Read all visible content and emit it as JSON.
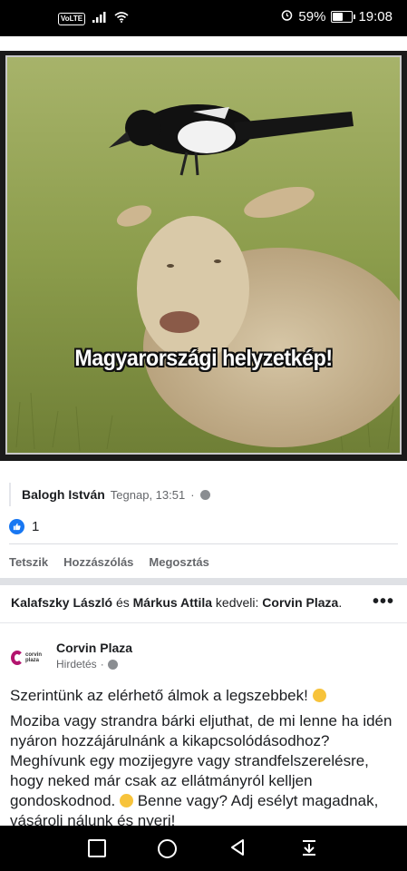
{
  "status_bar": {
    "volte": "VoLTE",
    "battery_percent": "59%",
    "battery_level": 0.59,
    "time": "19:08",
    "icons": [
      "volte-icon",
      "signal-icon",
      "wifi-icon",
      "alarm-icon",
      "battery-icon"
    ]
  },
  "photo": {
    "caption": "Magyarországi helyzetkép!"
  },
  "comment": {
    "author": "Balogh István",
    "time": "Tegnap, 13:51",
    "separator": "·"
  },
  "reactions": {
    "count": "1",
    "icon": "like-icon",
    "accent": "#1877f2"
  },
  "actions": {
    "like": "Tetszik",
    "comment": "Hozzászólás",
    "share": "Megosztás"
  },
  "liked_by": {
    "user1": "Kalafszky László",
    "conjunction": "és",
    "user2": "Márkus Attila",
    "verb": "kedveli:",
    "page": "Corvin Plaza",
    "period": "."
  },
  "ad": {
    "logo_text": "corvin plaza",
    "page_name": "Corvin Plaza",
    "sponsored": "Hirdetés",
    "separator": "·",
    "brand_color": "#b3146e",
    "paragraph1": "Szerintünk az elérhető álmok a legszebbek! ",
    "paragraph2a": "Moziba vagy strandra bárki eljuthat, de mi lenne ha idén nyáron hozzájárulnánk a kikapcsolódásodhoz? Meghívunk egy mozijegyre vagy strandfelszerelésre, hogy neked már csak az ellátmányról kelljen gondoskodnod. ",
    "paragraph2b": " Benne vagy? Adj esélyt magadnak, vásárolj nálunk és nyerj!"
  },
  "navbar": {
    "icons": [
      "recent-apps-icon",
      "home-icon",
      "back-icon",
      "notification-drawer-icon"
    ]
  }
}
